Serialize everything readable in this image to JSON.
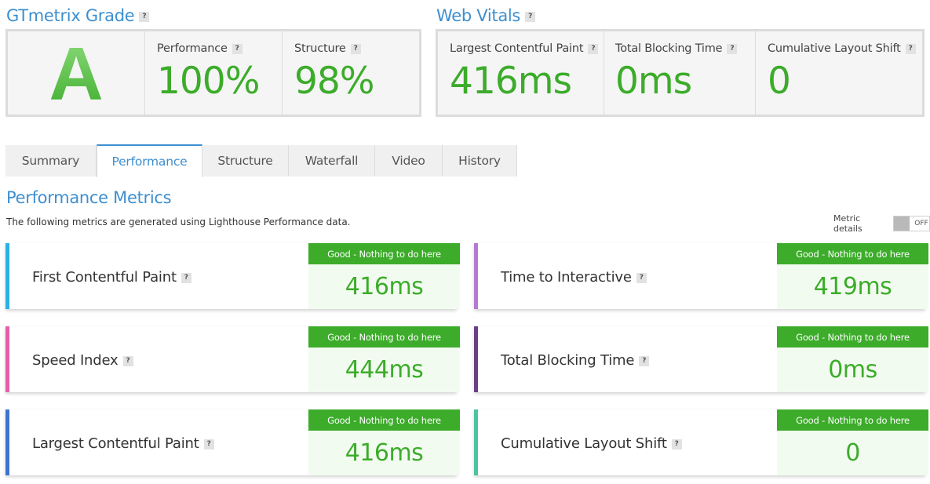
{
  "grade": {
    "title": "GTmetrix Grade",
    "letter": "A",
    "performance_label": "Performance",
    "performance_value": "100%",
    "structure_label": "Structure",
    "structure_value": "98%"
  },
  "vitals": {
    "title": "Web Vitals",
    "lcp_label": "Largest Contentful Paint",
    "lcp_value": "416ms",
    "tbt_label": "Total Blocking Time",
    "tbt_value": "0ms",
    "cls_label": "Cumulative Layout Shift",
    "cls_value": "0"
  },
  "tabs": [
    "Summary",
    "Performance",
    "Structure",
    "Waterfall",
    "Video",
    "History"
  ],
  "active_tab": "Performance",
  "performance": {
    "title": "Performance Metrics",
    "description": "The following metrics are generated using Lighthouse Performance data.",
    "metric_details_label": "Metric details",
    "toggle_state": "OFF"
  },
  "metrics": [
    {
      "name": "First Contentful Paint",
      "badge": "Good - Nothing to do here",
      "value": "416ms",
      "color": "#2ab0e6"
    },
    {
      "name": "Time to Interactive",
      "badge": "Good - Nothing to do here",
      "value": "419ms",
      "color": "#b57bd0"
    },
    {
      "name": "Speed Index",
      "badge": "Good - Nothing to do here",
      "value": "444ms",
      "color": "#e65ea8"
    },
    {
      "name": "Total Blocking Time",
      "badge": "Good - Nothing to do here",
      "value": "0ms",
      "color": "#6a3f88"
    },
    {
      "name": "Largest Contentful Paint",
      "badge": "Good - Nothing to do here",
      "value": "416ms",
      "color": "#3d74d0"
    },
    {
      "name": "Cumulative Layout Shift",
      "badge": "Good - Nothing to do here",
      "value": "0",
      "color": "#4cc4a0"
    }
  ],
  "colors": {
    "accent_blue": "#3d8fd0",
    "good_green": "#3cac2a"
  },
  "help_glyph": "?"
}
